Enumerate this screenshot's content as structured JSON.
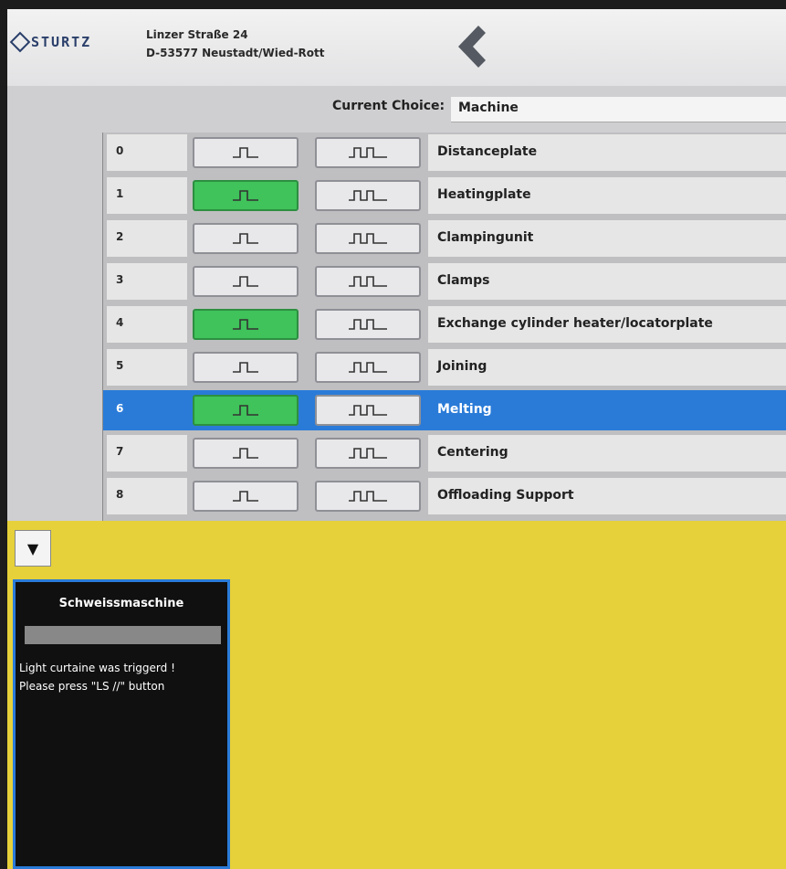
{
  "header": {
    "logo_text": "STURTZ",
    "address_line1": "Linzer Straße 24",
    "address_line2": "D-53577 Neustadt/Wied-Rott"
  },
  "current_choice": {
    "label": "Current Choice:",
    "value": "Machine"
  },
  "rows": [
    {
      "index": "0",
      "name": "Distanceplate",
      "single_active": false,
      "selected": false
    },
    {
      "index": "1",
      "name": "Heatingplate",
      "single_active": true,
      "selected": false
    },
    {
      "index": "2",
      "name": "Clampingunit",
      "single_active": false,
      "selected": false
    },
    {
      "index": "3",
      "name": "Clamps",
      "single_active": false,
      "selected": false
    },
    {
      "index": "4",
      "name": "Exchange cylinder heater/locatorplate",
      "single_active": true,
      "selected": false
    },
    {
      "index": "5",
      "name": "Joining",
      "single_active": false,
      "selected": false
    },
    {
      "index": "6",
      "name": "Melting",
      "single_active": true,
      "selected": true
    },
    {
      "index": "7",
      "name": "Centering",
      "single_active": false,
      "selected": false
    },
    {
      "index": "8",
      "name": "Offloading Support",
      "single_active": false,
      "selected": false
    }
  ],
  "panel": {
    "collapse_icon": "triangle-down-icon",
    "dialog": {
      "title": "Schweissmaschine",
      "message_line1": "Light curtaine was triggerd !",
      "message_line2": "Please press \"LS //\" button"
    }
  },
  "colors": {
    "active_green": "#3fc35a",
    "selected_blue": "#2a7bd8",
    "panel_yellow": "#e6d13a"
  }
}
